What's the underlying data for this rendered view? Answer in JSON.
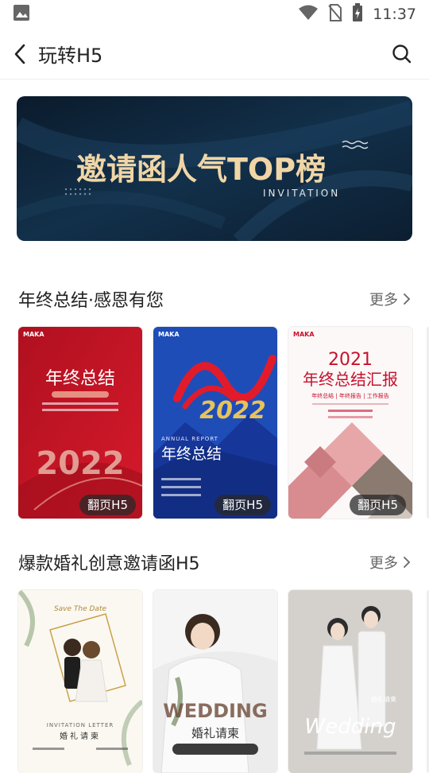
{
  "status": {
    "time": "11:37"
  },
  "header": {
    "title": "玩转H5"
  },
  "banner": {
    "title": "邀请函人气TOP榜",
    "subtitle": "INVITATION"
  },
  "sections": [
    {
      "title": "年终总结·感恩有您",
      "more": "更多",
      "cards": [
        {
          "brand": "MAKA",
          "headline": "年终总结",
          "year": "2022",
          "tag": "翻页H5"
        },
        {
          "brand": "MAKA",
          "headline": "年终总结",
          "sub": "ANNUAL REPORT",
          "tag": "翻页H5"
        },
        {
          "brand": "MAKA",
          "year": "2021",
          "headline": "年终总结汇报",
          "sub": "年终总结 | 年终报告 | 工作报告",
          "tag": "翻页H5"
        }
      ]
    },
    {
      "title": "爆款婚礼创意邀请函H5",
      "more": "更多",
      "cards": [
        {
          "script": "Save The Date",
          "sub": "INVITATION LETTER",
          "headline": "婚礼请柬"
        },
        {
          "script": "WEDDING",
          "headline": "婚礼请柬"
        },
        {
          "script": "Wedding",
          "headline": "婚礼请柬"
        }
      ]
    }
  ],
  "colors": {
    "accent_red": "#c8102e",
    "blue": "#1b3ea6",
    "dark_banner": "#0f2236",
    "gold": "#f0d6a6"
  }
}
